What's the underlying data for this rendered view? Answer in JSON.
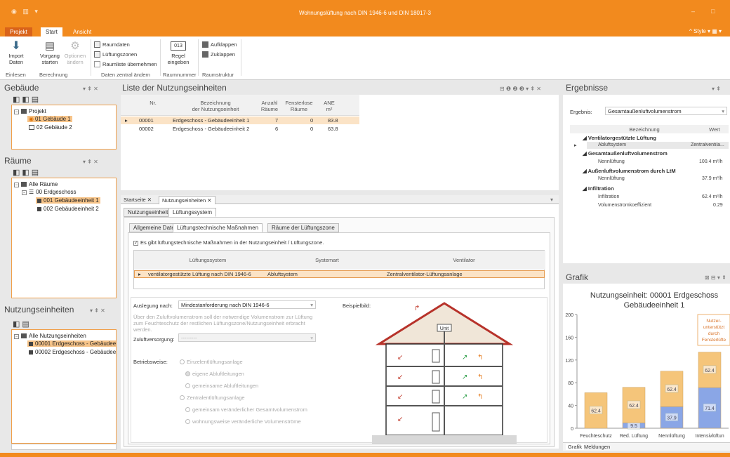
{
  "window": {
    "title": "Wohnungslüftung nach DIN 1946-6 und DIN 18017-3",
    "style_label": "Style"
  },
  "ribbon": {
    "tabs": [
      {
        "label": "Projekt"
      },
      {
        "label": "Start"
      },
      {
        "label": "Ansicht"
      }
    ],
    "btn_import": "Import\nDaten",
    "btn_vorgang": "Vorgang\nstarten",
    "btn_optionen": "Optionen\nändern",
    "btn_raumdaten": "Raumdaten",
    "btn_lueftungszonen": "Lüftungszonen",
    "chk_raumliste": "Raumliste übernehmen",
    "regel_value": "013",
    "btn_regel": "Regel\neingeben",
    "btn_aufklappen": "Aufklappen",
    "btn_zuklappen": "Zuklappen",
    "groups": [
      "Einlesen",
      "Berechnung",
      "Daten zentral ändern",
      "Raumnummer",
      "Raumstruktur"
    ]
  },
  "gebaeude": {
    "title": "Gebäude",
    "items": [
      "Projekt",
      "01 Gebäude 1",
      "02 Gebäude 2"
    ]
  },
  "raeume": {
    "title": "Räume",
    "items": [
      "Alle Räume",
      "00 Erdgeschoss",
      "001 Gebäudeeinheit 1",
      "002 Gebäudeeinheit 2"
    ]
  },
  "nutzungseinheiten": {
    "title": "Nutzungseinheiten",
    "items": [
      "Alle Nutzungseinheiten",
      "00001 Erdgeschoss - Gebäudeei",
      "00002 Erdgeschoss - Gebäudeei"
    ]
  },
  "liste": {
    "title": "Liste der Nutzungseinheiten",
    "headers": {
      "nr": "Nr.",
      "bez": "Bezeichnung\nder Nutzungseinheit",
      "anzahl": "Anzahl\nRäume",
      "fenster": "Fensterlose\nRäume",
      "anf": "ANE\nm²"
    },
    "rows": [
      {
        "nr": "00001",
        "bez": "Erdgeschoss - Gebäudeeinheit 1",
        "anzahl": "7",
        "fenster": "0",
        "anf": "83.8"
      },
      {
        "nr": "00002",
        "bez": "Erdgeschoss - Gebäudeeinheit 2",
        "anzahl": "6",
        "fenster": "0",
        "anf": "63.8"
      }
    ]
  },
  "doc_tabs": [
    "Startseite",
    "Nutzungseinheiten"
  ],
  "sub_tabs": [
    "Nutzungseinheit",
    "Lüftungssystem"
  ],
  "inner_tabs": [
    "Allgemeine Daten",
    "Lüftungstechnische Maßnahmen",
    "Räume der Lüftungszone"
  ],
  "massnahmen": {
    "checkbox": "Es gibt lüftungstechnische Maßnahmen in der Nutzungseinheit / Lüftungszone.",
    "headers": {
      "system": "Lüftungssystem",
      "art": "Systemart",
      "vent": "Ventilator"
    },
    "row": {
      "system": "ventilatorgestützte Lüftung nach DIN 1946-6",
      "art": "Abluftsystem",
      "vent": "Zentralventilator-Lüftungsanlage"
    }
  },
  "auslegung": {
    "label": "Auslegung nach:",
    "value": "Mindestanforderung nach DIN 1946-6",
    "hint": "Über den Zuluftvolumenstrom soll der notwendige Volumenstrom zur Lüftung zum Feuchteschutz der restlichen Lüftungszone/Nutzungseinheit erbracht werden.",
    "zuluft_label": "Zuluftversorgung:",
    "zuluft_value": "---------",
    "betrieb_label": "Betriebsweise:",
    "options": [
      "Einzelentlüftungsanlage",
      "eigene Abluftleitungen",
      "gemeinsame Abluftleitungen",
      "Zentralentlüftungsanlage",
      "gemeinsam veränderlicher Gesamtvolumenstrom",
      "wohnungsweise veränderliche Volumenströme"
    ],
    "beispiel": "Beispielbild:",
    "unit_label": "Unit"
  },
  "ergebnisse": {
    "title": "Ergebnisse",
    "label": "Ergebnis:",
    "value": "Gesamtaußenluftvolumenstrom",
    "headers": {
      "bez": "Bezeichnung",
      "wert": "Wert"
    },
    "groups": [
      {
        "title": "Ventilatorgestützte Lüftung",
        "rows": [
          {
            "name": "Abluftsystem",
            "val": "Zentralventila..."
          }
        ]
      },
      {
        "title": "Gesamtaußenluftvolumenstrom",
        "rows": [
          {
            "name": "Nennlüftung",
            "val": "100.4 m³/h"
          }
        ]
      },
      {
        "title": "Außenluftvolumenstrom durch LtM",
        "rows": [
          {
            "name": "Nennlüftung",
            "val": "37.9 m³/h"
          }
        ]
      },
      {
        "title": "Infiltration",
        "rows": [
          {
            "name": "Infiltration",
            "val": "62.4 m³/h"
          },
          {
            "name": "Volumenstromkoeffizient",
            "val": "0.29"
          }
        ]
      }
    ]
  },
  "grafik": {
    "title": "Grafik",
    "tabs": [
      "Grafik",
      "Meldungen"
    ],
    "callout": "Nutzer-\nunterstützt\ndurch\nFensterlüfte"
  },
  "colors": {
    "accent": "#f28a1e",
    "bar_orange": "#f5c57a",
    "bar_blue": "#8aa6e6"
  },
  "chart_data": {
    "type": "bar",
    "title": "Nutzungseinheit: 00001 Erdgeschoss Gebäudeeinheit 1",
    "categories": [
      "Feuchteschutz",
      "Red. Lüftung",
      "Nennlüftung",
      "Intensivlüftun"
    ],
    "ylim": [
      0,
      200
    ],
    "yticks": [
      0,
      40,
      80,
      120,
      160,
      200
    ],
    "series": [
      {
        "values": [
          0,
          9.5,
          37.9,
          71.4
        ],
        "labels": [
          "",
          "9.5",
          "37.9",
          "71.4"
        ]
      },
      {
        "values": [
          62.4,
          62.4,
          62.4,
          62.4
        ],
        "labels": [
          "62.4",
          "62.4",
          "62.4",
          "62.4"
        ]
      }
    ]
  }
}
